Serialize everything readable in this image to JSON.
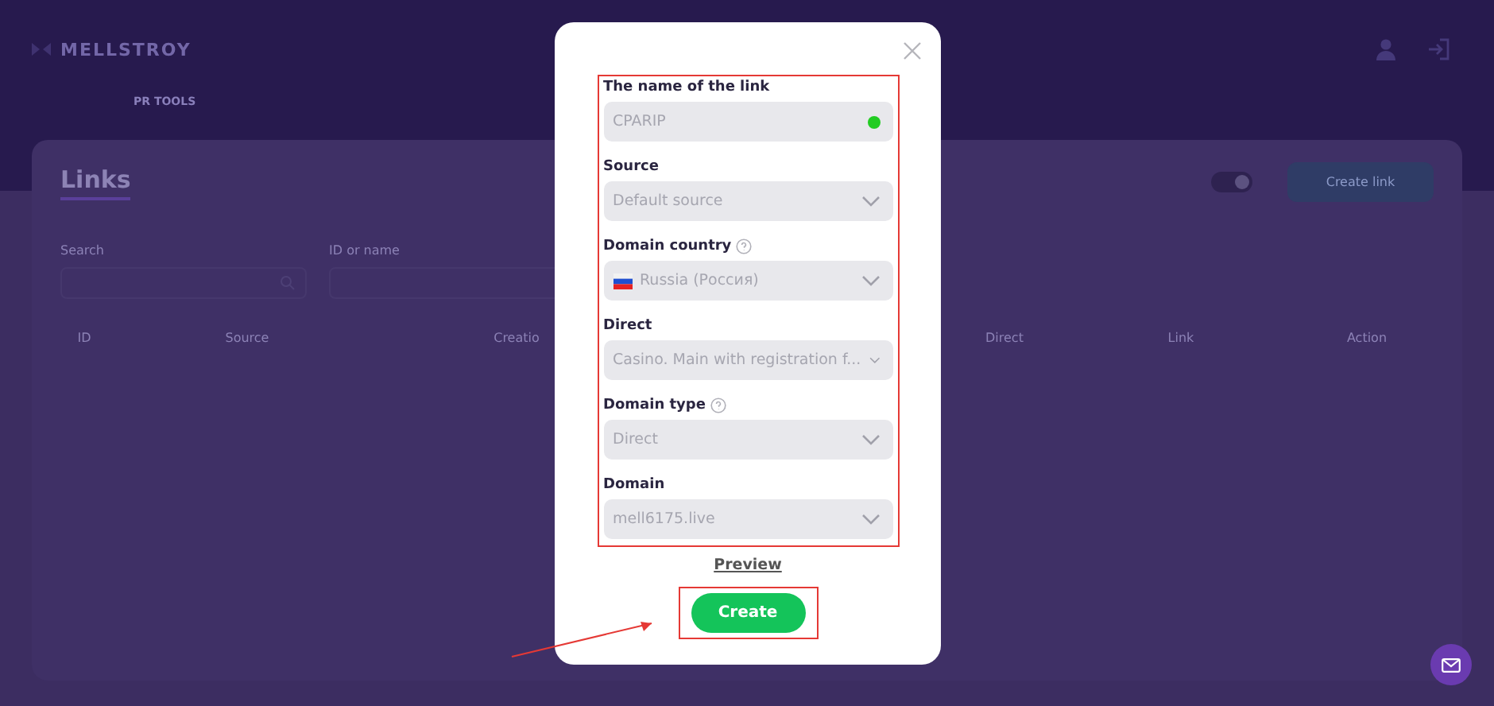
{
  "header": {
    "logo": "MELLSTROY",
    "nav": [
      {
        "label": "PR TOOLS",
        "selected": true
      }
    ]
  },
  "page": {
    "title": "Links",
    "filters": [
      {
        "label": "Search"
      },
      {
        "label": "ID or name"
      }
    ],
    "create_button": "Create link",
    "notify_toggle": {
      "on": true
    },
    "table": {
      "columns": [
        "ID",
        "Source",
        "Creatio",
        "Direct",
        "Link",
        "Action"
      ]
    }
  },
  "modal": {
    "fields": [
      {
        "kind": "input",
        "label": "The name of the link",
        "value": "CPARIP",
        "help": false,
        "valid": true
      },
      {
        "kind": "select",
        "label": "Source",
        "value": "Default source",
        "help": false
      },
      {
        "kind": "select",
        "label": "Domain country",
        "value": "Russia (Россия)",
        "help": true,
        "flag": true
      },
      {
        "kind": "select",
        "label": "Direct",
        "value": "Casino. Main with registration f...",
        "help": false
      },
      {
        "kind": "select",
        "label": "Domain type",
        "value": "Direct",
        "help": true
      },
      {
        "kind": "select",
        "label": "Domain",
        "value": "mell6175.live",
        "help": false
      }
    ],
    "preview_link": "Preview",
    "create_button": "Create"
  }
}
